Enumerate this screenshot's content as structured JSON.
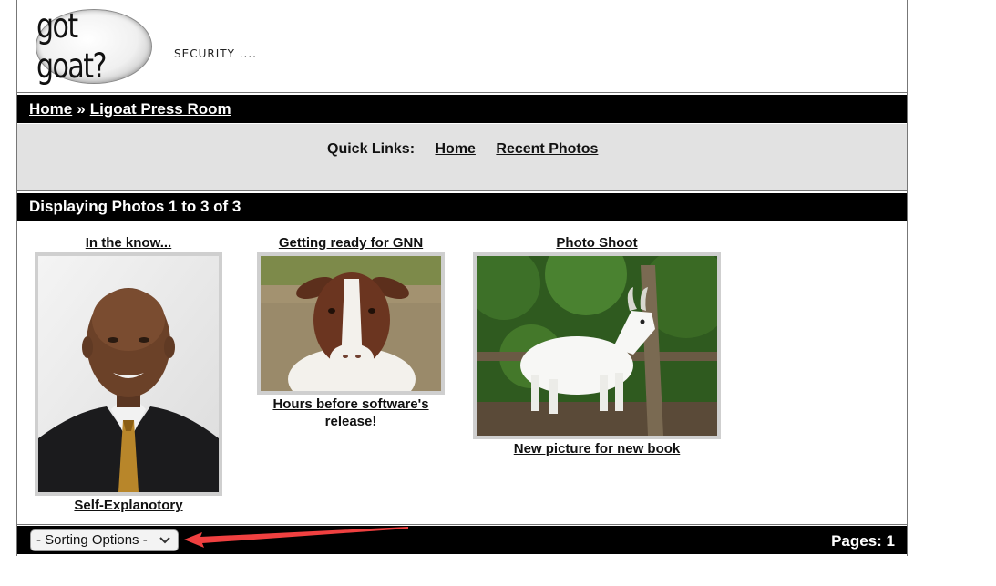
{
  "header": {
    "logo_text": "got goat?",
    "tagline": "SECURITY ...."
  },
  "breadcrumb": {
    "home": "Home",
    "separator": "»",
    "current": "Ligoat Press Room"
  },
  "quick_links": {
    "label": "Quick Links:",
    "items": [
      "Home",
      "Recent Photos"
    ]
  },
  "display": {
    "text": "Displaying Photos 1 to 3 of 3"
  },
  "photos": [
    {
      "title": "In the know...",
      "caption": "Self-Explanotory"
    },
    {
      "title": "Getting ready for GNN",
      "caption": "Hours before software's release!"
    },
    {
      "title": "Photo Shoot",
      "caption": "New picture for new book"
    }
  ],
  "footer": {
    "sort_label": "- Sorting Options -",
    "pages": "Pages: 1"
  },
  "colors": {
    "bar": "#000000",
    "quick_bar": "#e2e2e2",
    "frame": "#cfcfcf",
    "annotation_arrow": "#f04040"
  }
}
